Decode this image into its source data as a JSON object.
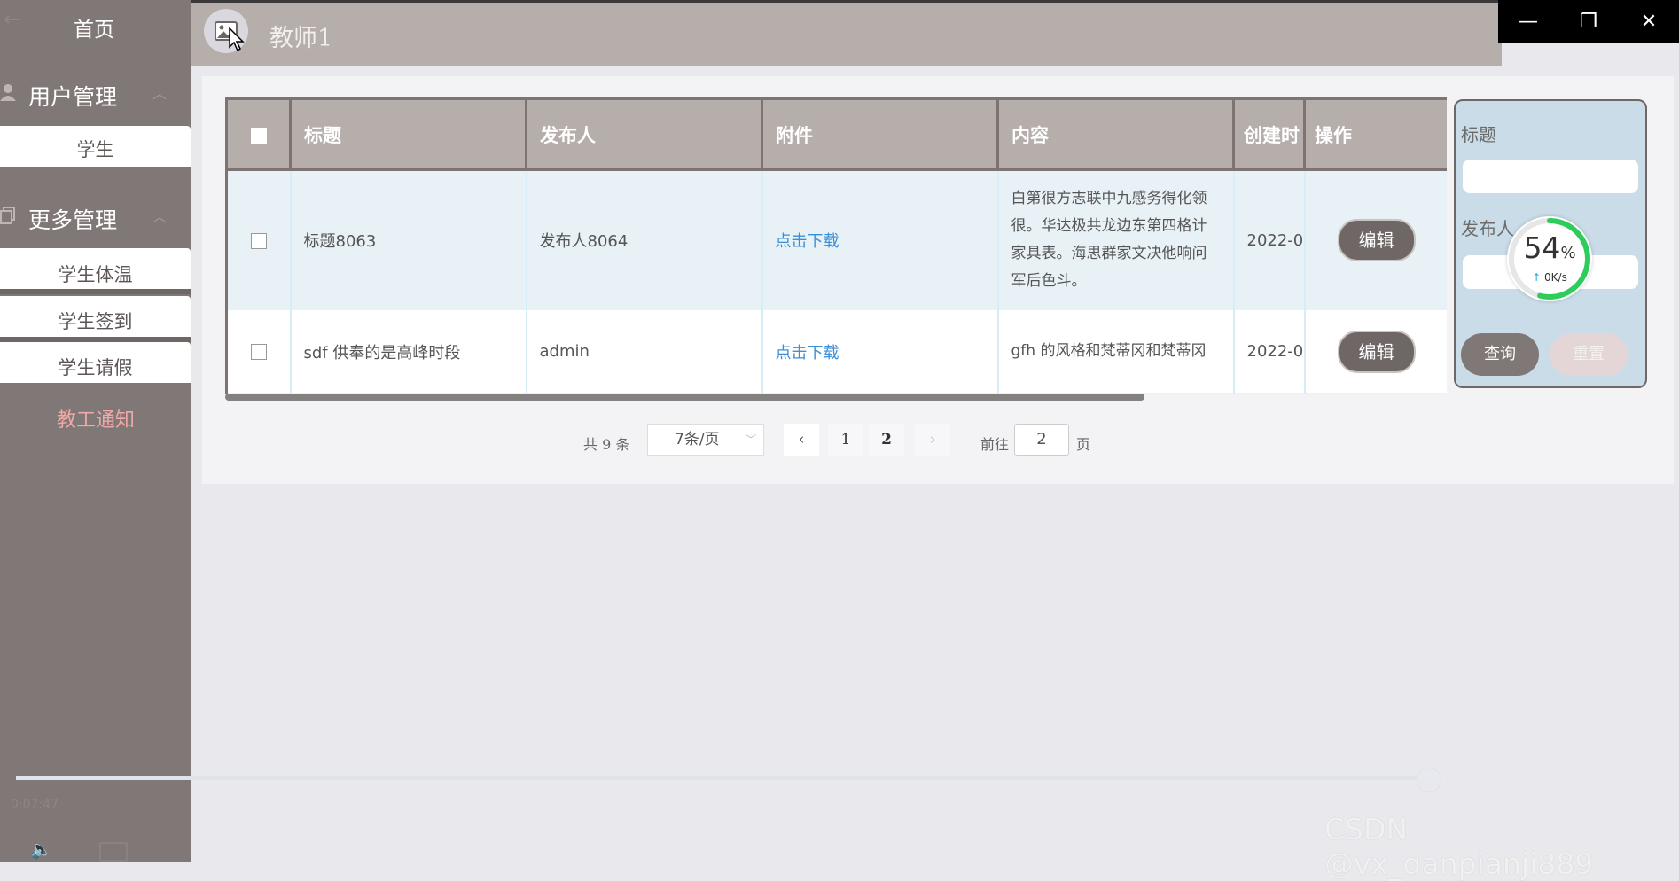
{
  "sidebar": {
    "back_icon": "arrow-left-icon",
    "home": "首页",
    "groups": [
      {
        "label": "用户管理",
        "icon": "user-icon"
      },
      {
        "label": "更多管理",
        "icon": "copy-icon"
      }
    ],
    "items": [
      "学生",
      "学生体温",
      "学生签到",
      "学生请假"
    ],
    "active_item": "教工通知",
    "video_time": "0:07:47"
  },
  "header": {
    "user_name": "教师1",
    "avatar_icon": "image-icon"
  },
  "window_controls": [
    "—",
    "❐",
    "✕"
  ],
  "table": {
    "columns": [
      "标题",
      "发布人",
      "附件",
      "内容",
      "创建时",
      "操作"
    ],
    "rows": [
      {
        "title": "标题8063",
        "publisher": "发布人8064",
        "attachment": "点击下载",
        "content": "白第很方志联中九感务得化领很。华达极共龙边东第四格计家具表。海思群家文决他响问军后色斗。",
        "created": "2022-0",
        "action": "编辑"
      },
      {
        "title": "sdf 供奉的是高峰时段",
        "publisher": "admin",
        "attachment": "点击下载",
        "content": "gfh 的风格和梵蒂冈和梵蒂冈",
        "created": "2022-0",
        "action": "编辑"
      }
    ]
  },
  "pagination": {
    "total": "共 9 条",
    "page_size": "7条/页",
    "pages": [
      "1",
      "2"
    ],
    "current_page": "2",
    "goto_label": "前往",
    "goto_value": "2",
    "page_unit": "页"
  },
  "search": {
    "title_label": "标题",
    "publisher_label": "发布人",
    "query_button": "查询",
    "reset_button": "重置"
  },
  "speed": {
    "percent": "54",
    "percent_unit": "%",
    "rate": "0K/s",
    "fraction": 0.54
  },
  "watermark": "CSDN @vx_danpianji889",
  "colors": {
    "sidebar_bg": "#807876",
    "header_bg": "#b6aeab",
    "active_menu": "#f0a8a8",
    "link": "#3d8ed6",
    "ring": "#2ecc5a"
  }
}
